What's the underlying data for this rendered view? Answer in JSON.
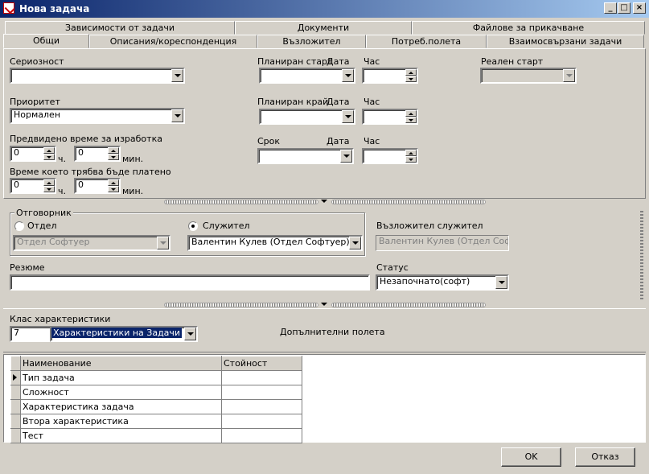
{
  "window": {
    "title": "Нова задача",
    "controls": {
      "minimize": "_",
      "maximize": "□",
      "close": "×"
    }
  },
  "tabs": {
    "row1": [
      "Зависимости от задачи",
      "Документи",
      "Файлове за прикачване"
    ],
    "row2": [
      "Общи",
      "Описания/кореспонденция",
      "Възложител",
      "Потреб.полета",
      "Взаимосвързани задачи"
    ],
    "active": "Общи"
  },
  "form": {
    "severity_label": "Сериозност",
    "severity_value": "",
    "priority_label": "Приоритет",
    "priority_value": "Нормален",
    "est_time_label": "Предвидено време за изработка",
    "est_hours": "0",
    "est_minutes": "0",
    "paid_time_label": "Време което трябва бъде платено",
    "paid_hours": "0",
    "paid_minutes": "0",
    "hours_unit": "ч.",
    "minutes_unit": "мин.",
    "planned_start_label": "Планиран старт",
    "planned_end_label": "Планиран край",
    "deadline_label": "Срок",
    "date_label": "Дата",
    "hour_label": "Час",
    "actual_start_label": "Реален старт"
  },
  "responsible": {
    "group_label": "Отговорник",
    "department_option": "Отдел",
    "employee_option": "Служител",
    "department_value": "Отдел Софтуер",
    "employee_value": "Валентин Кулев (Отдел Софтуер)",
    "assigner_label": "Възложител служител",
    "assigner_value": "Валентин Кулев (Отдел Софтуе",
    "summary_label": "Резюме",
    "summary_value": "",
    "status_label": "Статус",
    "status_value": "Незапочнато(софт)"
  },
  "characteristics": {
    "class_label": "Клас характеристики",
    "class_code": "7",
    "class_value": "Характеристики на Задачи",
    "additional_fields_label": "Допълнителни полета",
    "table_headers": [
      "Наименование",
      "Стойност"
    ],
    "rows": [
      {
        "name": "Тип задача",
        "value": ""
      },
      {
        "name": "Сложност",
        "value": ""
      },
      {
        "name": "Характеристика задача",
        "value": ""
      },
      {
        "name": "Втора характеристика",
        "value": ""
      },
      {
        "name": "Тест",
        "value": ""
      }
    ]
  },
  "buttons": {
    "ok": "OK",
    "cancel": "Отказ"
  },
  "colors": {
    "titlebar_start": "#0a246a",
    "titlebar_end": "#a6caf0",
    "selection": "#0a246a",
    "face": "#d4d0c8"
  }
}
